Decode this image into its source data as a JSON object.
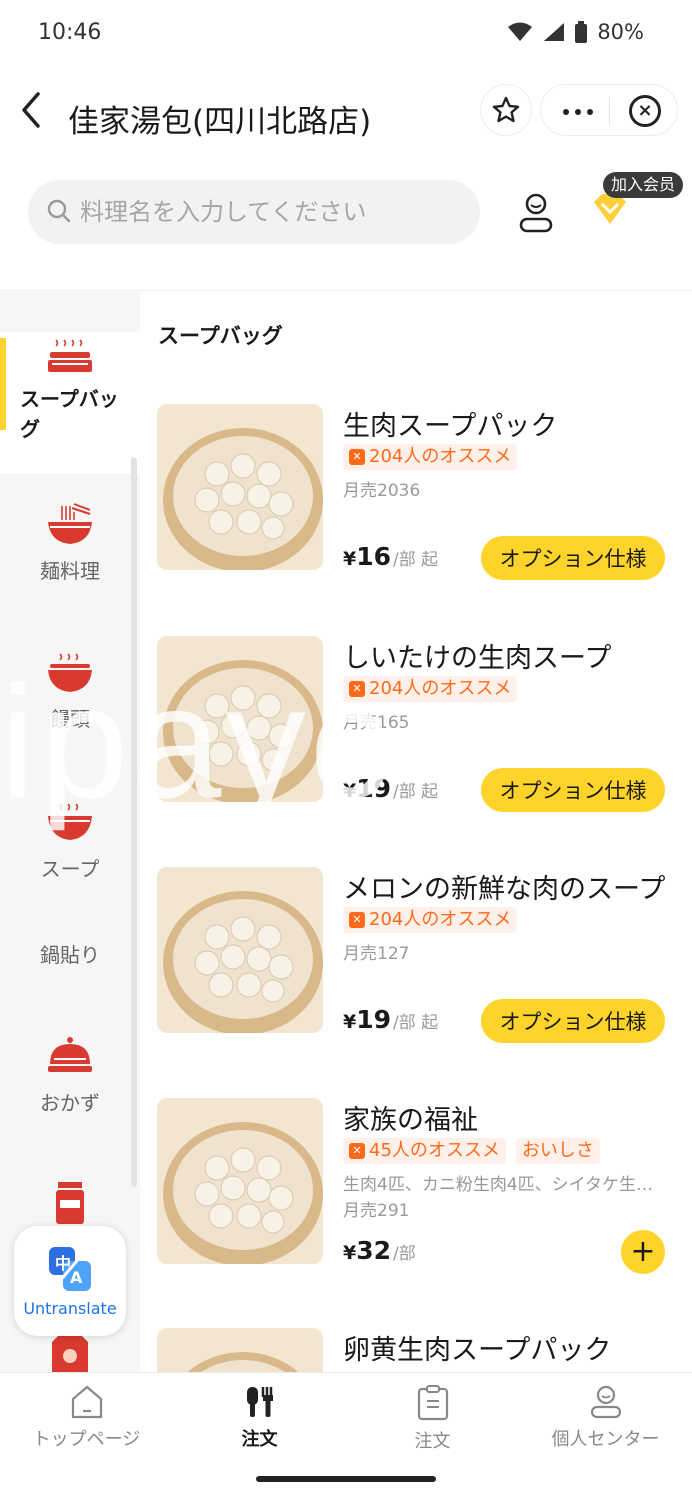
{
  "status_bar": {
    "time": "10:46",
    "battery": "80%"
  },
  "header": {
    "title": "佳家湯包(四川北路店)"
  },
  "search": {
    "placeholder": "料理名を入力してください"
  },
  "vip": {
    "badge": "加入会员"
  },
  "sidebar": {
    "categories": [
      {
        "label": "スープバッグ",
        "icon": "steamer-icon",
        "active": true
      },
      {
        "label": "麺料理",
        "icon": "noodle-bowl-icon"
      },
      {
        "label": "饅頭",
        "icon": "bun-bowl-icon"
      },
      {
        "label": "スープ",
        "icon": "soup-bowl-icon"
      },
      {
        "label": "鍋貼り",
        "icon": null
      },
      {
        "label": "おかず",
        "icon": "dish-cover-icon"
      }
    ]
  },
  "untranslate": {
    "label": "Untranslate"
  },
  "section": {
    "title": "スープバッグ"
  },
  "items": [
    {
      "name": "生肉スープパック",
      "tags": [
        "204人のオススメ"
      ],
      "sold": "月売2036",
      "price_symbol": "¥",
      "price": "16",
      "unit": "/部 起",
      "action": "オプション仕様"
    },
    {
      "name": "しいたけの生肉スープ",
      "tags": [
        "204人のオススメ"
      ],
      "sold": "月売165",
      "price_symbol": "¥",
      "price": "19",
      "unit": "/部 起",
      "action": "オプション仕様"
    },
    {
      "name": "メロンの新鮮な肉のスープ",
      "tags": [
        "204人のオススメ"
      ],
      "sold": "月売127",
      "price_symbol": "¥",
      "price": "19",
      "unit": "/部 起",
      "action": "オプション仕様"
    },
    {
      "name": "家族の福祉",
      "tags": [
        "45人のオススメ",
        "おいしさ"
      ],
      "desc": "生肉4匹、カニ粉生肉4匹、シイタケ生肉4匹",
      "sold": "月売291",
      "price_symbol": "¥",
      "price": "32",
      "unit": "/部",
      "action": "+"
    },
    {
      "name": "卵黄生肉スープパック"
    }
  ],
  "watermark": "ipayc",
  "bottom_nav": [
    {
      "label": "トップページ",
      "icon": "home-icon"
    },
    {
      "label": "注文",
      "icon": "utensils-icon",
      "active": true
    },
    {
      "label": "注文",
      "icon": "clipboard-icon"
    },
    {
      "label": "個人センター",
      "icon": "person-icon"
    }
  ],
  "colors": {
    "accent": "#ffd42a",
    "tag": "#ff6a1a",
    "icon_red": "#d93a2f"
  }
}
